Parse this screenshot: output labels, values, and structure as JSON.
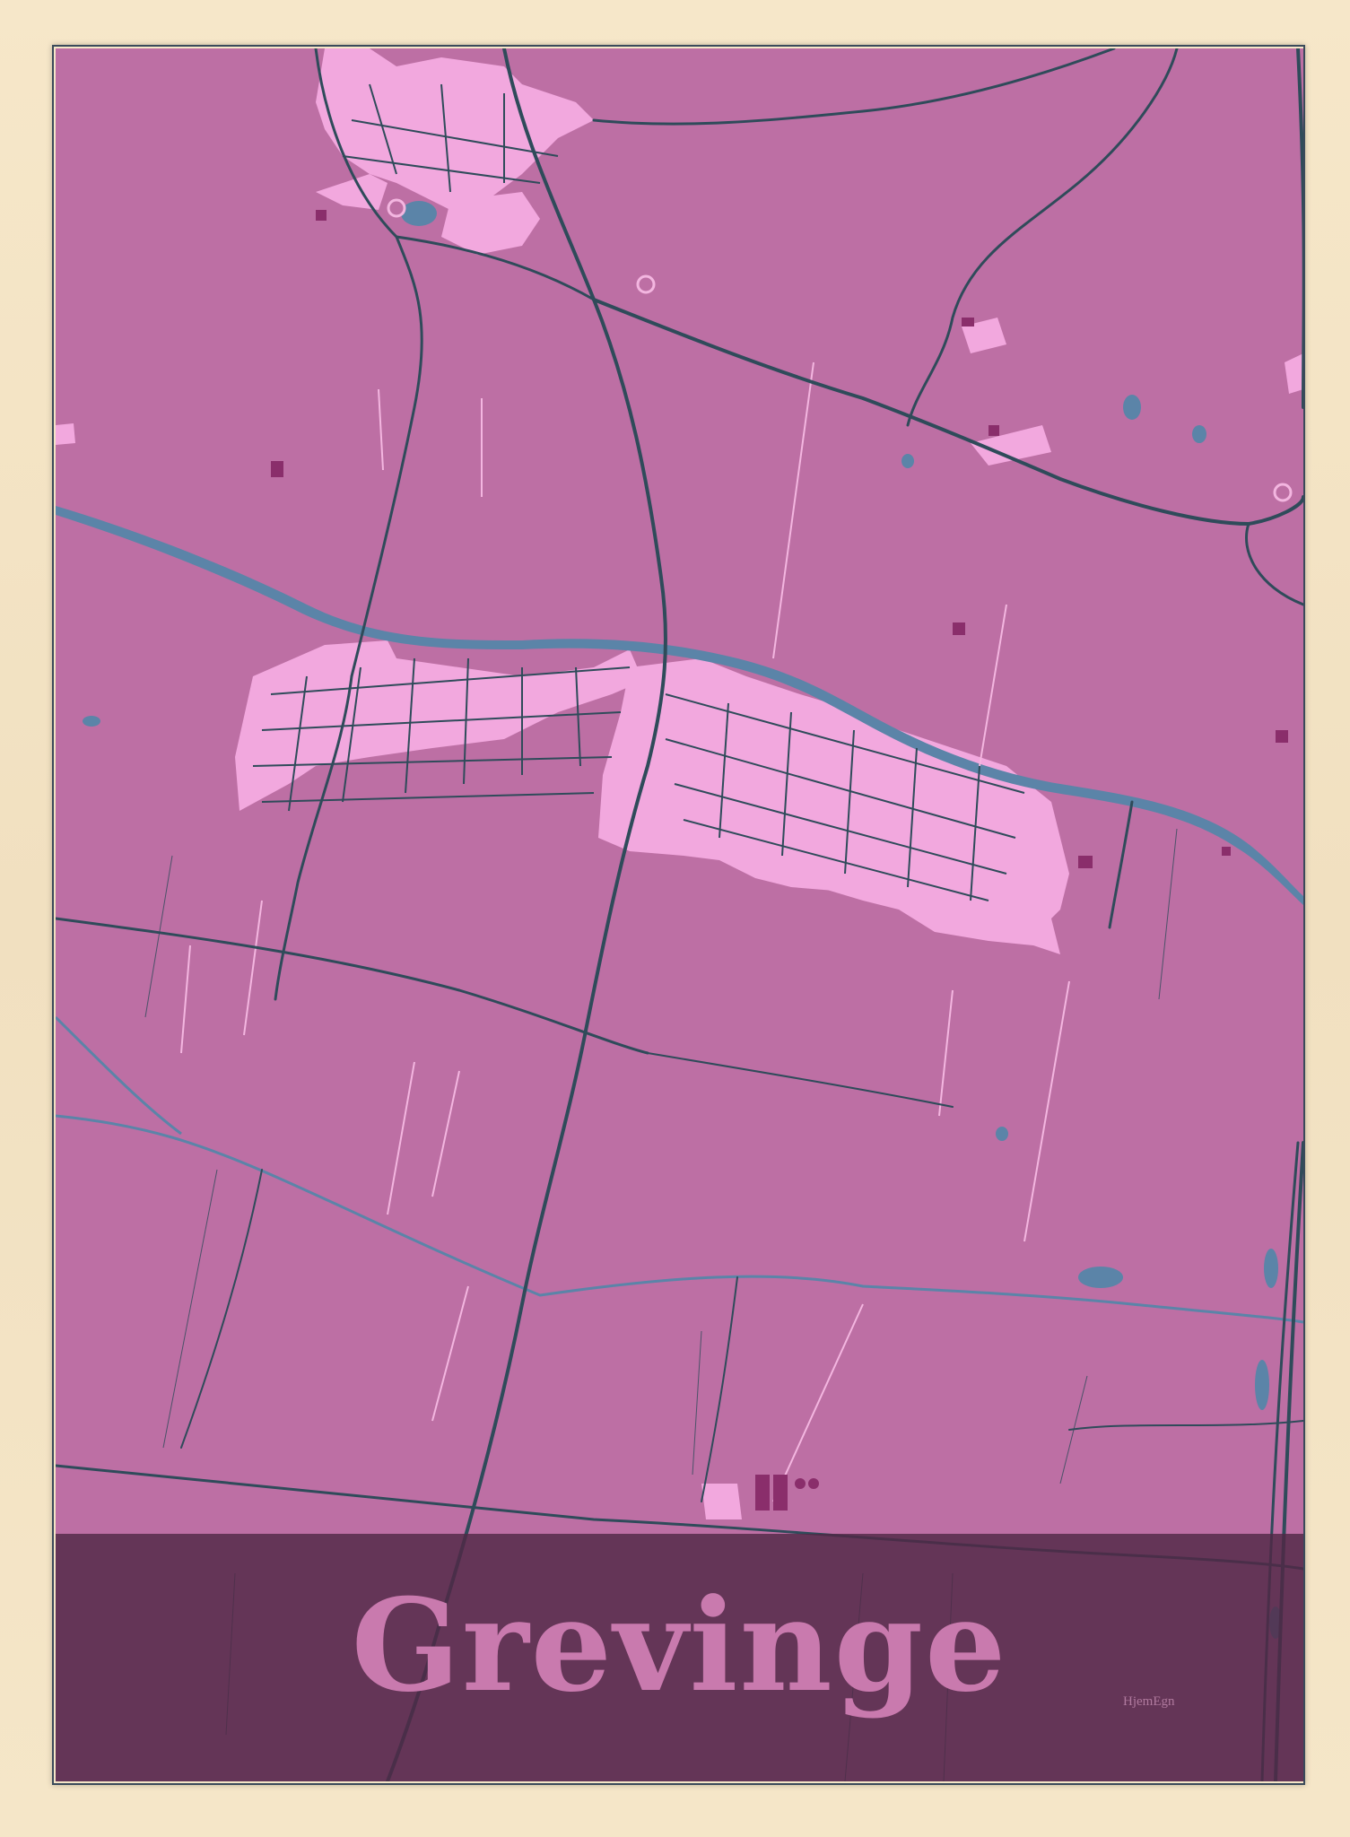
{
  "poster": {
    "town_name": "Grevinge",
    "brand": "HjemEgn"
  },
  "colors": {
    "frame": "#f4e4c6",
    "land": "#bd6fa4",
    "urban": "#f2a8de",
    "building": "#8a2e6b",
    "road": "#2f4b5a",
    "water": "#5b84a8",
    "footpath": "#f3b6e0",
    "title_band": "#502846",
    "title_text": "#c97aae"
  },
  "icons": {
    "roundabout": "circle-outline-icon"
  }
}
